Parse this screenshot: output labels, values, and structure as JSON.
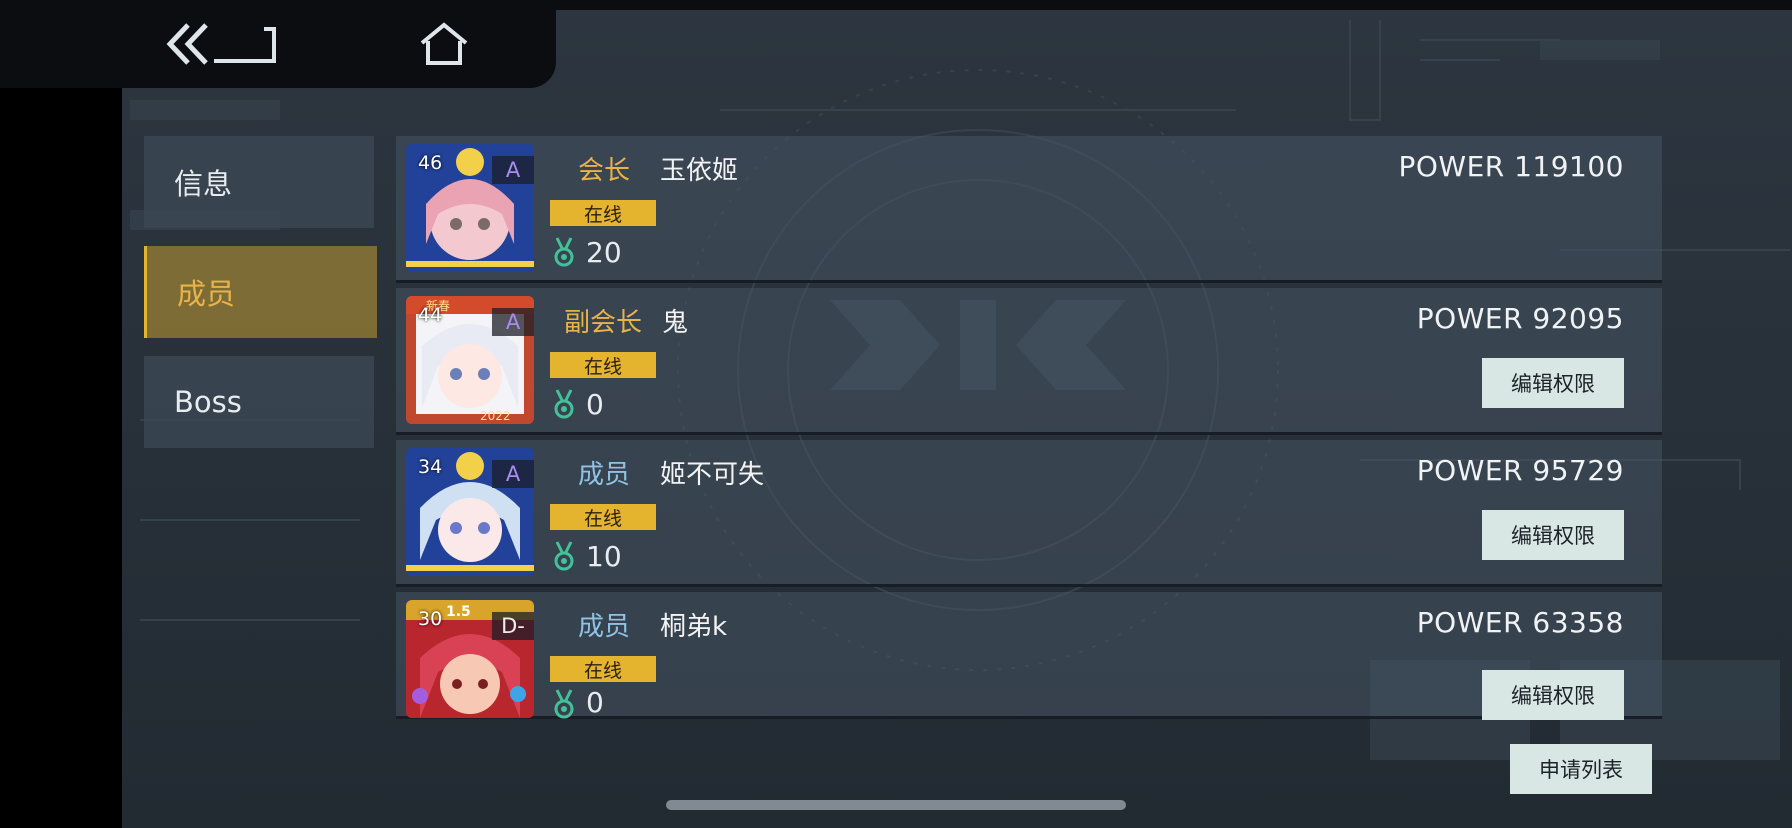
{
  "nav": {
    "back_icon": "double-chevron-left-back",
    "home_icon": "home"
  },
  "tabs": [
    {
      "label": "信息",
      "active": false
    },
    {
      "label": "成员",
      "active": true
    },
    {
      "label": "Boss",
      "active": false
    }
  ],
  "background_logo": "SDQ-GENE",
  "members": [
    {
      "level": "46",
      "grade": "A",
      "role": "会长",
      "role_color": "#e8b34a",
      "name": "玉依姬",
      "status": "在线",
      "medal": "20",
      "power": "POWER 119100",
      "edit_label": ""
    },
    {
      "level": "44",
      "grade": "A",
      "role": "副会长",
      "role_color": "#e8b34a",
      "name": "鬼",
      "status": "在线",
      "medal": "0",
      "power": "POWER 92095",
      "edit_label": "编辑权限",
      "badge_text": "新春",
      "year_text": "2022"
    },
    {
      "level": "34",
      "grade": "A",
      "role": "成员",
      "role_color": "#8fc3e6",
      "name": "姬不可失",
      "status": "在线",
      "medal": "10",
      "power": "POWER 95729",
      "edit_label": "编辑权限"
    },
    {
      "level": "30",
      "grade": "D-",
      "role": "成员",
      "role_color": "#8fc3e6",
      "name": "桐弟k",
      "status": "在线",
      "medal": "0",
      "power": "POWER 63358",
      "edit_label": "编辑权限",
      "badge_text": "1.5"
    }
  ],
  "apply_list_label": "申请列表",
  "colors": {
    "accent_gold": "#e5b42e",
    "role_leader": "#e8b34a",
    "role_member": "#8fc3e6",
    "medal": "#43c29a",
    "button_bg": "#d8e6e4"
  }
}
